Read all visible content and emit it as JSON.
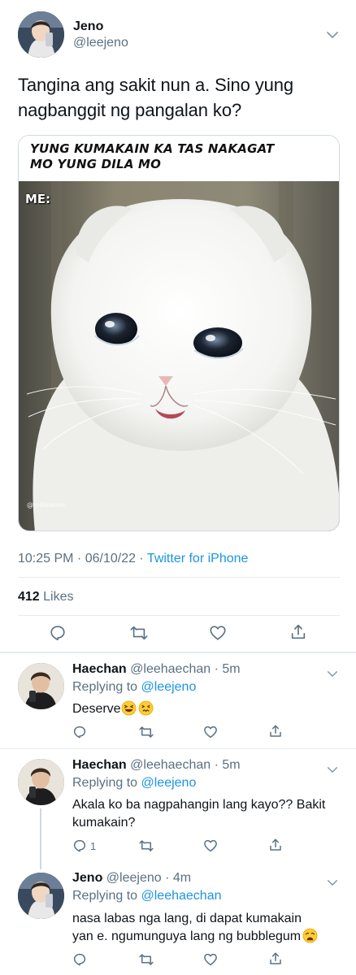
{
  "tweet": {
    "author_name": "Jeno",
    "author_handle": "@leejeno",
    "text_line1": "Tangina ang sakit nun a. Sino yung",
    "text_line2": "nagbanggit ng pangalan ko?",
    "meme": {
      "caption_line1": "YUNG KUMAKAIN KA TAS NAKAGAT",
      "caption_line2": "MO YUNG DILA MO",
      "label": "ME:",
      "watermark": "@lydiaamei"
    },
    "time": "10:25 PM · 06/10/22 · ",
    "source": "Twitter for iPhone",
    "likes_count": "412",
    "likes_label": "Likes"
  },
  "replies": [
    {
      "name": "Haechan",
      "handle_time": "@leehaechan · 5m",
      "replying_label": "Replying to",
      "replying_to": "@leejeno",
      "text": "Deserve",
      "emojis": [
        "laughing-squint",
        "confounded"
      ],
      "reply_count": ""
    },
    {
      "name": "Haechan",
      "handle_time": "@leehaechan · 5m",
      "replying_label": "Replying to",
      "replying_to": "@leejeno",
      "text_line1": "Akala ko ba nagpahangin lang kayo?? Bakit",
      "text_line2": "kumakain?",
      "reply_count": "1"
    },
    {
      "name": "Jeno",
      "handle_time": "@leejeno · 4m",
      "replying_label": "Replying to",
      "replying_to": "@leehaechan",
      "text_line1": "nasa labas nga lang, di dapat kumakain",
      "text_line2": "yan e. ngumunguya lang ng bubblegum",
      "emojis": [
        "weary"
      ],
      "reply_count": ""
    }
  ],
  "colors": {
    "accent": "#1b95e0",
    "secondary_text": "#5b7083",
    "divider": "#e6ecf0"
  },
  "icons": [
    "chevron-down-icon",
    "reply-icon",
    "retweet-icon",
    "like-icon",
    "share-icon"
  ]
}
